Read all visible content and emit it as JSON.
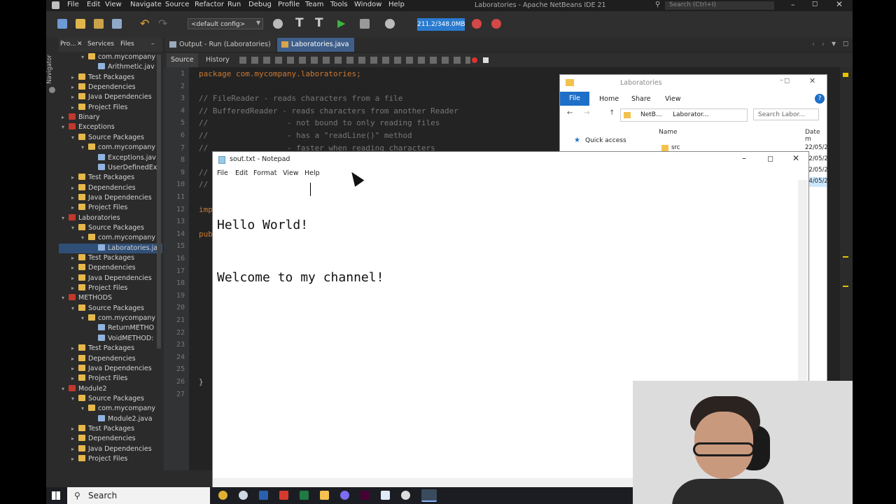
{
  "app": {
    "title": "Laboratories - Apache NetBeans IDE 21",
    "menu": [
      "File",
      "Edit",
      "View",
      "Navigate",
      "Source",
      "Refactor",
      "Run",
      "Debug",
      "Profile",
      "Team",
      "Tools",
      "Window",
      "Help"
    ],
    "search_placeholder": "Search (Ctrl+I)"
  },
  "toolbar": {
    "config": "<default config>",
    "memory": "211.2/348.0MB"
  },
  "navigator_label": "Navigator",
  "project_panel": {
    "tabs": [
      "Pro...",
      "Services",
      "Files"
    ],
    "tree": [
      {
        "label": "com.mycompany",
        "indent": 2,
        "icon": "package",
        "twisty": "v"
      },
      {
        "label": "Arithmetic.jav",
        "indent": 3,
        "icon": "java",
        "twisty": ""
      },
      {
        "label": "Test Packages",
        "indent": 1,
        "icon": "folder",
        "twisty": ">"
      },
      {
        "label": "Dependencies",
        "indent": 1,
        "icon": "folder",
        "twisty": ">"
      },
      {
        "label": "Java Dependencies",
        "indent": 1,
        "icon": "folder",
        "twisty": ">"
      },
      {
        "label": "Project Files",
        "indent": 1,
        "icon": "folder",
        "twisty": ">"
      },
      {
        "label": "Binary",
        "indent": 0,
        "icon": "project",
        "twisty": ">"
      },
      {
        "label": "Exceptions",
        "indent": 0,
        "icon": "project",
        "twisty": "v"
      },
      {
        "label": "Source Packages",
        "indent": 1,
        "icon": "folder",
        "twisty": "v"
      },
      {
        "label": "com.mycompany",
        "indent": 2,
        "icon": "package",
        "twisty": "v"
      },
      {
        "label": "Exceptions.jav",
        "indent": 3,
        "icon": "java",
        "twisty": ""
      },
      {
        "label": "UserDefinedEx",
        "indent": 3,
        "icon": "java",
        "twisty": ""
      },
      {
        "label": "Test Packages",
        "indent": 1,
        "icon": "folder",
        "twisty": ">"
      },
      {
        "label": "Dependencies",
        "indent": 1,
        "icon": "folder",
        "twisty": ">"
      },
      {
        "label": "Java Dependencies",
        "indent": 1,
        "icon": "folder",
        "twisty": ">"
      },
      {
        "label": "Project Files",
        "indent": 1,
        "icon": "folder",
        "twisty": ">"
      },
      {
        "label": "Laboratories",
        "indent": 0,
        "icon": "project",
        "twisty": "v"
      },
      {
        "label": "Source Packages",
        "indent": 1,
        "icon": "folder",
        "twisty": "v"
      },
      {
        "label": "com.mycompany",
        "indent": 2,
        "icon": "package",
        "twisty": "v"
      },
      {
        "label": "Laboratories.ja",
        "indent": 3,
        "icon": "java",
        "twisty": "",
        "selected": true
      },
      {
        "label": "Test Packages",
        "indent": 1,
        "icon": "folder",
        "twisty": ">"
      },
      {
        "label": "Dependencies",
        "indent": 1,
        "icon": "folder",
        "twisty": ">"
      },
      {
        "label": "Java Dependencies",
        "indent": 1,
        "icon": "folder",
        "twisty": ">"
      },
      {
        "label": "Project Files",
        "indent": 1,
        "icon": "folder",
        "twisty": ">"
      },
      {
        "label": "METHODS",
        "indent": 0,
        "icon": "project",
        "twisty": "v"
      },
      {
        "label": "Source Packages",
        "indent": 1,
        "icon": "folder",
        "twisty": "v"
      },
      {
        "label": "com.mycompany",
        "indent": 2,
        "icon": "package",
        "twisty": "v"
      },
      {
        "label": "ReturnMETHO",
        "indent": 3,
        "icon": "java",
        "twisty": ""
      },
      {
        "label": "VoidMETHOD:",
        "indent": 3,
        "icon": "java",
        "twisty": ""
      },
      {
        "label": "Test Packages",
        "indent": 1,
        "icon": "folder",
        "twisty": ">"
      },
      {
        "label": "Dependencies",
        "indent": 1,
        "icon": "folder",
        "twisty": ">"
      },
      {
        "label": "Java Dependencies",
        "indent": 1,
        "icon": "folder",
        "twisty": ">"
      },
      {
        "label": "Project Files",
        "indent": 1,
        "icon": "folder",
        "twisty": ">"
      },
      {
        "label": "Module2",
        "indent": 0,
        "icon": "project",
        "twisty": "v"
      },
      {
        "label": "Source Packages",
        "indent": 1,
        "icon": "folder",
        "twisty": "v"
      },
      {
        "label": "com.mycompany",
        "indent": 2,
        "icon": "package",
        "twisty": "v"
      },
      {
        "label": "Module2.java",
        "indent": 3,
        "icon": "java",
        "twisty": ""
      },
      {
        "label": "Test Packages",
        "indent": 1,
        "icon": "folder",
        "twisty": ">"
      },
      {
        "label": "Dependencies",
        "indent": 1,
        "icon": "folder",
        "twisty": ">"
      },
      {
        "label": "Java Dependencies",
        "indent": 1,
        "icon": "folder",
        "twisty": ">"
      },
      {
        "label": "Project Files",
        "indent": 1,
        "icon": "folder",
        "twisty": ">"
      }
    ]
  },
  "editor": {
    "tabs": [
      {
        "label": "Output - Run (Laboratories)",
        "active": false
      },
      {
        "label": "Laboratories.java",
        "active": true
      }
    ],
    "source_tab": "Source",
    "history_tab": "History",
    "line_numbers": [
      "1",
      "2",
      "3",
      "4",
      "5",
      "6",
      "7",
      "8",
      "9",
      "10",
      "11",
      "12",
      "13",
      "14",
      "15",
      "16",
      "17",
      "18",
      "19",
      "20",
      "21",
      "22",
      "23",
      "24",
      "25",
      "26",
      "27"
    ],
    "lines": [
      {
        "text": "package com.mycompany.laboratories;",
        "kind": "kw",
        "line": 1
      },
      {
        "text": "// FileReader - reads characters from a file",
        "kind": "cm",
        "line": 3
      },
      {
        "text": "// BufferedReader - reads characters from another Reader",
        "kind": "cm",
        "line": 4
      },
      {
        "text": "//                 - not bound to only reading files",
        "kind": "cm",
        "line": 5
      },
      {
        "text": "//                 - has a \"readLine()\" method",
        "kind": "cm",
        "line": 6
      },
      {
        "text": "//                 - faster when reading characters",
        "kind": "cm",
        "line": 7
      },
      {
        "text": "//",
        "kind": "cm",
        "line": 9
      },
      {
        "text": "//",
        "kind": "cm",
        "line": 10
      },
      {
        "text": "imp",
        "kind": "kw",
        "line": 12
      },
      {
        "text": "pub",
        "kind": "kw",
        "line": 14
      },
      {
        "text": "}",
        "kind": "plain",
        "line": 26
      }
    ]
  },
  "explorer": {
    "title": "Laboratories",
    "ribbon": [
      "File",
      "Home",
      "Share",
      "View"
    ],
    "breadcrumb": [
      "NetB...",
      "Laborator..."
    ],
    "search_placeholder": "Search Labor...",
    "quick_access": "Quick access",
    "col_name": "Name",
    "col_date": "Date m",
    "items": [
      {
        "name": "src",
        "date": "22/05/2"
      },
      {
        "name": "",
        "date": "22/05/2"
      },
      {
        "name": "",
        "date": "22/05/2"
      },
      {
        "name": "",
        "date": "24/05/2"
      }
    ]
  },
  "notepad": {
    "title": "sout.txt - Notepad",
    "menu": [
      "File",
      "Edit",
      "Format",
      "View",
      "Help"
    ],
    "content_lines": [
      "Hello World!",
      "Welcome to my channel!"
    ]
  },
  "taskbar": {
    "search_label": "Search"
  }
}
